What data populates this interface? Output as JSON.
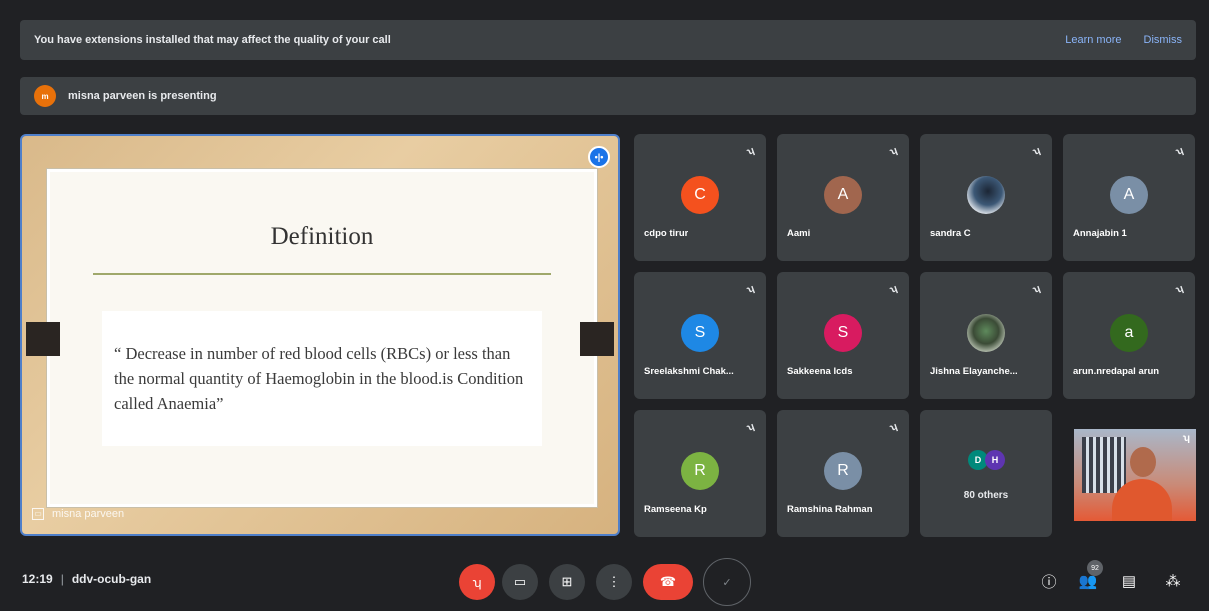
{
  "banner": {
    "message": "You have extensions installed that may affect the quality of your call",
    "learn_more": "Learn more",
    "dismiss": "Dismiss"
  },
  "presenting": {
    "avatar_initial": "m",
    "text": "misna parveen is presenting"
  },
  "slide": {
    "title": "Definition",
    "body": "“ Decrease in number of  red blood cells (RBCs) or less than the normal quantity of  Haemoglobin in the blood.is Condition called Anaemia”",
    "presenter_name": "misna parveen"
  },
  "participants": [
    {
      "name": "cdpo tirur",
      "initial": "C",
      "color": "#f4511e"
    },
    {
      "name": "Aami",
      "initial": "A",
      "color": "#a1664e"
    },
    {
      "name": "sandra C",
      "initial": "",
      "color": "",
      "photo": true
    },
    {
      "name": "Annajabin 1",
      "initial": "A",
      "color": "#7a8fa6"
    },
    {
      "name": "Sreelakshmi Chak...",
      "initial": "S",
      "color": "#1e88e5"
    },
    {
      "name": "Sakkeena Icds",
      "initial": "S",
      "color": "#d81b60"
    },
    {
      "name": "Jishna Elayanche...",
      "initial": "",
      "color": "",
      "photo": true
    },
    {
      "name": "arun.nredapal arun",
      "initial": "a",
      "color": "#33691e"
    },
    {
      "name": "Ramseena Kp",
      "initial": "R",
      "color": "#7cb342"
    },
    {
      "name": "Ramshina Rahman",
      "initial": "R",
      "color": "#7a8fa6"
    }
  ],
  "others_tile": {
    "label": "80 others",
    "avatars": [
      {
        "initial": "D",
        "color": "#00897b"
      },
      {
        "initial": "H",
        "color": "#5e35b1"
      }
    ]
  },
  "bottom": {
    "time": "12:19",
    "meeting_code": "ddv-ocub-gan",
    "people_count": "92"
  }
}
